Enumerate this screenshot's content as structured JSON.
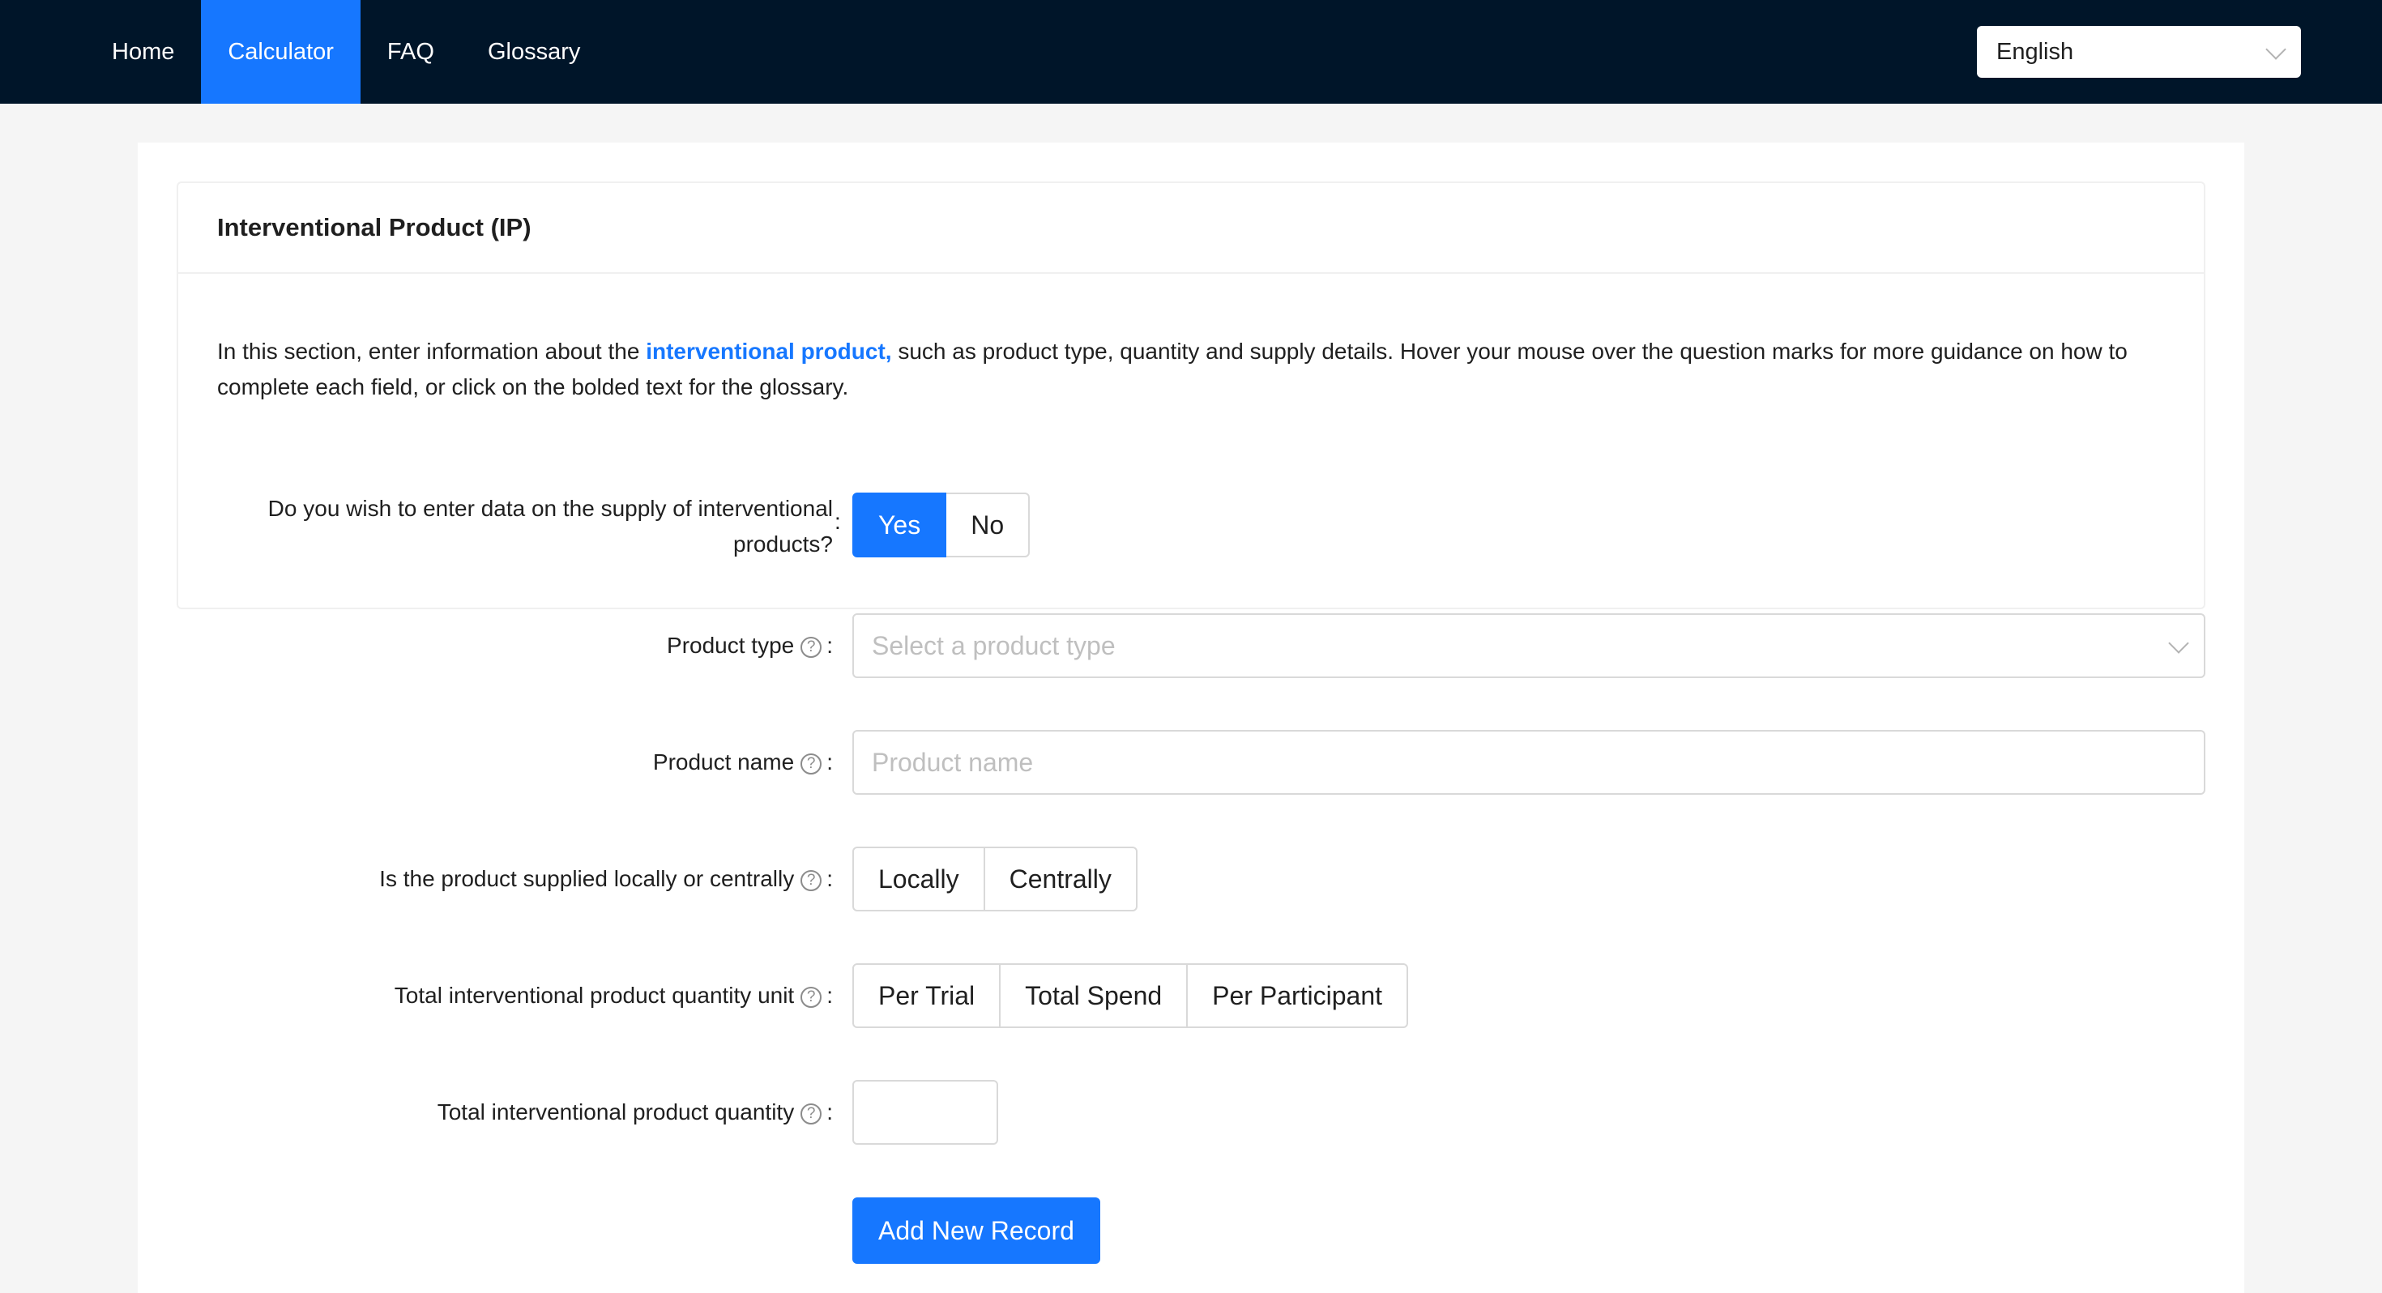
{
  "nav": {
    "items": [
      {
        "label": "Home",
        "active": false
      },
      {
        "label": "Calculator",
        "active": true
      },
      {
        "label": "FAQ",
        "active": false
      },
      {
        "label": "Glossary",
        "active": false
      }
    ],
    "language": "English"
  },
  "section": {
    "title": "Interventional Product (IP)",
    "intro_before": "In this section, enter information about the ",
    "intro_link": "interventional product,",
    "intro_after": " such as product type, quantity and supply details. Hover your mouse over the question marks for more guidance on how to complete each field, or click on the bolded text for the glossary."
  },
  "form": {
    "enter_supply": {
      "label": "Do you wish to enter data on the supply of interventional products?",
      "options": [
        "Yes",
        "No"
      ],
      "selected": "Yes"
    },
    "product_type": {
      "label": "Product type",
      "placeholder": "Select a product type"
    },
    "product_name": {
      "label": "Product name",
      "placeholder": "Product name"
    },
    "supply_mode": {
      "label": "Is the product supplied locally or centrally",
      "options": [
        "Locally",
        "Centrally"
      ]
    },
    "quantity_unit": {
      "label": "Total interventional product quantity unit",
      "options": [
        "Per Trial",
        "Total Spend",
        "Per Participant"
      ]
    },
    "quantity": {
      "label": "Total interventional product quantity",
      "value": ""
    },
    "add_record_label": "Add New Record"
  },
  "colors": {
    "nav_bg": "#001529",
    "primary": "#1677ff",
    "page_bg": "#f5f5f5"
  },
  "icons": {
    "help": "question-circle-icon",
    "dropdown": "chevron-down-icon"
  }
}
